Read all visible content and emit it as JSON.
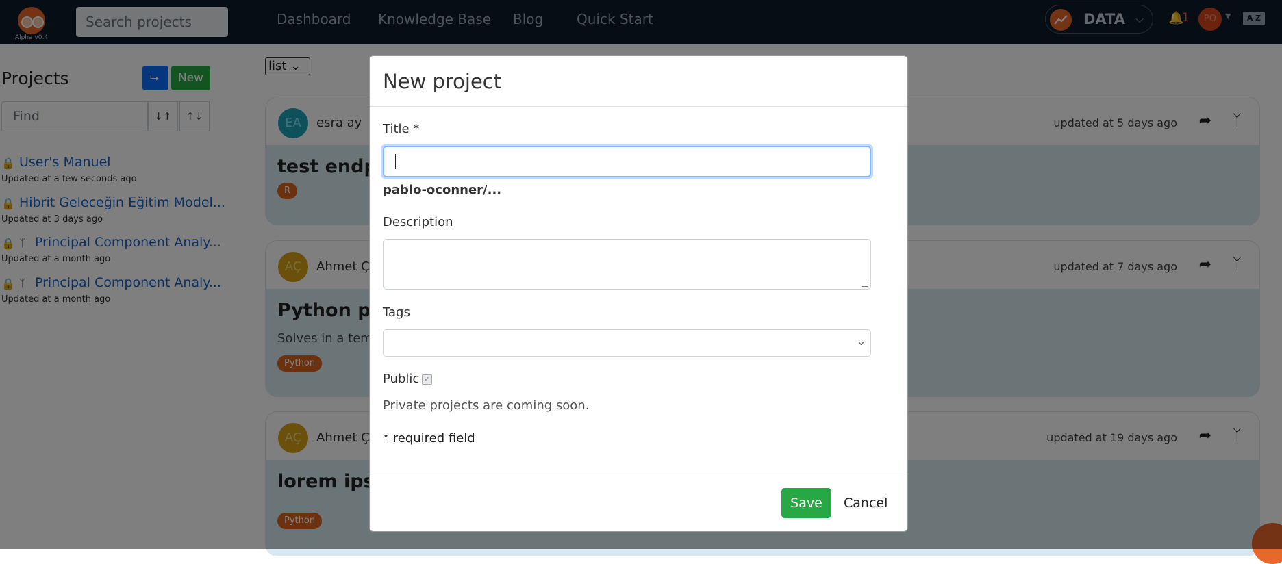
{
  "header": {
    "logo_version": "Alpha v0.4",
    "search_placeholder": "Search projects",
    "nav": [
      "Dashboard",
      "Knowledge Base",
      "Blog",
      "Quick Start"
    ],
    "data_menu": "DATA",
    "notification_count": "1",
    "user_initials": "PO",
    "lang_label": "A Z"
  },
  "sidebar": {
    "title": "Projects",
    "new_label": "New",
    "find_placeholder": "Find",
    "projects": [
      {
        "name": "User's Manuel",
        "updated": "Updated at a few seconds ago"
      },
      {
        "name": "Hibrit Geleceğin Eğitim Model...",
        "updated": "Updated at 3 days ago"
      },
      {
        "name": "Principal Component Analy...",
        "updated": "Updated at a month ago"
      },
      {
        "name": "Principal Component Analy...",
        "updated": "Updated at a month ago"
      }
    ]
  },
  "main": {
    "view_select": "list",
    "cards": [
      {
        "initials": "EA",
        "author": "esra ay",
        "updated": "updated at 5 days ago",
        "title": "test endpo",
        "description": "",
        "tag": "R"
      },
      {
        "initials": "AÇ",
        "author": "Ahmet Çiz",
        "updated": "updated at 7 days ago",
        "title": "Python pro",
        "description": "Solves in a tempo",
        "tag": "Python"
      },
      {
        "initials": "AÇ",
        "author": "Ahmet Çiz",
        "updated": "updated at 19 days ago",
        "title": "lorem ipsu",
        "description": "",
        "tag": "Python"
      }
    ]
  },
  "modal": {
    "title": "New project",
    "title_label": "Title *",
    "title_value": "",
    "slug": "pablo-oconner/...",
    "description_label": "Description",
    "description_value": "",
    "tags_label": "Tags",
    "public_label": "Public",
    "public_checked": true,
    "private_note": "Private projects are coming soon.",
    "required_note": "* required field",
    "save_label": "Save",
    "cancel_label": "Cancel"
  },
  "colors": {
    "topbar": "#0d1b2a",
    "accent_orange": "#e8672a",
    "primary_blue": "#0d6efd",
    "success_green": "#28a745",
    "card_body": "#d6e8ef"
  }
}
